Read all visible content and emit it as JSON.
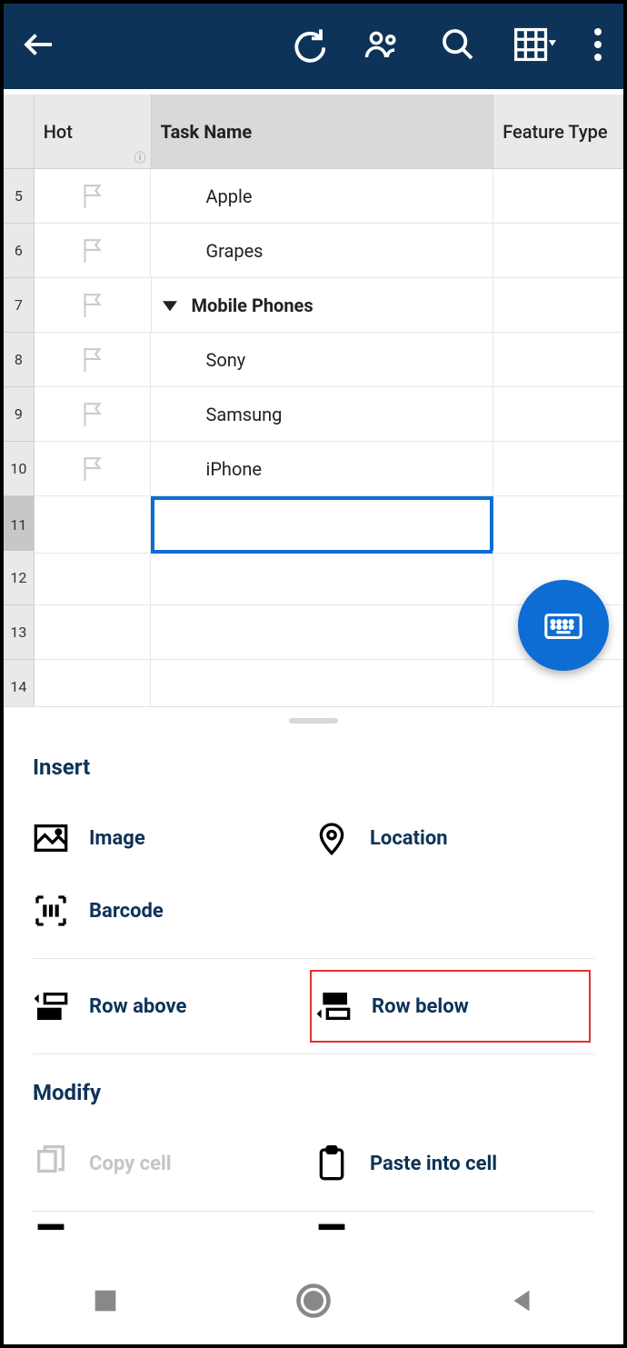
{
  "columns": {
    "hot": "Hot",
    "task": "Task Name",
    "feature": "Feature Type"
  },
  "rows": [
    {
      "num": "5",
      "task": "Apple",
      "parent": false,
      "flag": true
    },
    {
      "num": "6",
      "task": "Grapes",
      "parent": false,
      "flag": true
    },
    {
      "num": "7",
      "task": "Mobile Phones",
      "parent": true,
      "flag": true
    },
    {
      "num": "8",
      "task": "Sony",
      "parent": false,
      "flag": true
    },
    {
      "num": "9",
      "task": "Samsung",
      "parent": false,
      "flag": true
    },
    {
      "num": "10",
      "task": "iPhone",
      "parent": false,
      "flag": true
    },
    {
      "num": "11",
      "task": "",
      "parent": false,
      "flag": false,
      "selected": true
    },
    {
      "num": "12",
      "task": "",
      "parent": false,
      "flag": false
    },
    {
      "num": "13",
      "task": "",
      "parent": false,
      "flag": false
    },
    {
      "num": "14",
      "task": "",
      "parent": false,
      "flag": false
    }
  ],
  "panel": {
    "insert_title": "Insert",
    "modify_title": "Modify",
    "image": "Image",
    "location": "Location",
    "barcode": "Barcode",
    "row_above": "Row above",
    "row_below": "Row below",
    "copy_cell": "Copy cell",
    "paste_cell": "Paste into cell"
  }
}
